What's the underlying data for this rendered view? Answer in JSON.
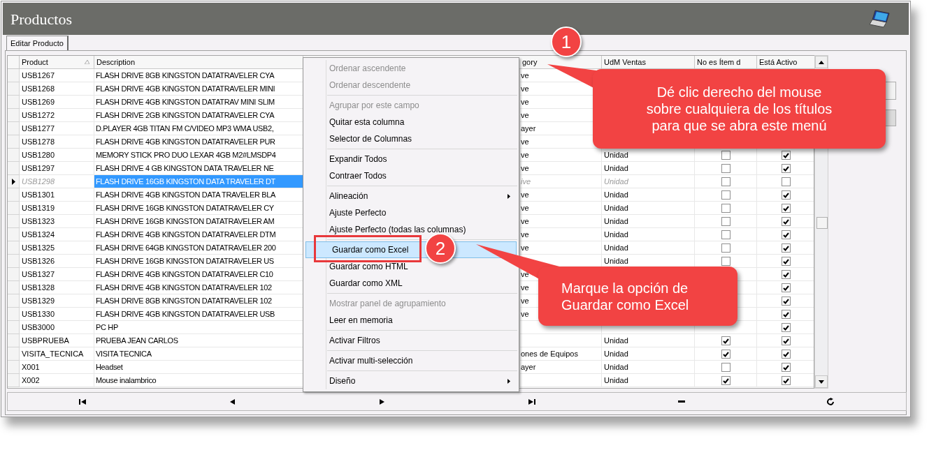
{
  "window": {
    "title": "Productos"
  },
  "tabs": [
    {
      "label": "Editar Producto",
      "selected": true
    }
  ],
  "table": {
    "columns": [
      {
        "label": "Product",
        "sorted": true
      },
      {
        "label": "Description",
        "sorted": false
      },
      {
        "label": "gory",
        "sorted": false
      },
      {
        "label": "UdM Ventas",
        "sorted": false
      },
      {
        "label": "No es Ítem d",
        "sorted": false
      },
      {
        "label": "Está Activo",
        "sorted": false
      }
    ],
    "rows": [
      {
        "current": false,
        "selected": false,
        "product": "USB1267",
        "description": "FLASH DRIVE 8GB KINGSTON DATATRAVELER CYA",
        "category": "ve"
      },
      {
        "current": false,
        "selected": false,
        "product": "USB1268",
        "description": "FLASH DRIVE 4GB KINGSTON DATATRAVELER MINI",
        "category": "ve"
      },
      {
        "current": false,
        "selected": false,
        "product": "USB1269",
        "description": "FLASH DRIVE 4GB KINGSTON DATATRAV MINI SLIM",
        "category": "ve"
      },
      {
        "current": false,
        "selected": false,
        "product": "USB1272",
        "description": "FLASH DRIVE 2GB KINGSTON DATATRAVELER CYA",
        "category": "ve"
      },
      {
        "current": false,
        "selected": false,
        "product": "USB1277",
        "description": "D.PLAYER 4GB TITAN FM C/VIDEO MP3 WMA USB2,",
        "category": "ayer"
      },
      {
        "current": false,
        "selected": false,
        "product": "USB1278",
        "description": "FLASH DRIVE 4GB KINGSTON DATATRAVELER PUR",
        "category": "ve"
      },
      {
        "current": false,
        "selected": false,
        "product": "USB1280",
        "description": "MEMORY STICK PRO DUO LEXAR 4GB M2#LMSDP4",
        "category": "ve",
        "udm": "Unidad",
        "not_item": false,
        "active": true
      },
      {
        "current": false,
        "selected": false,
        "product": "USB1297",
        "description": "FLASH DRIVE 4 GB KINGSTON DATA TRAVELER NE",
        "category": "ve",
        "udm": "Unidad",
        "not_item": false,
        "active": true
      },
      {
        "current": true,
        "selected": true,
        "product": "USB1298",
        "description": "FLASH DRIVE 16GB KINGSTON DATA TRAVELER DT",
        "category": "ive",
        "udm": "Unidad",
        "not_item": false,
        "active": false
      },
      {
        "current": false,
        "selected": false,
        "product": "USB1301",
        "description": "FLASH DRIVE 4GB KINGSTON DATA TRAVELER BLA",
        "category": "ve",
        "udm": "Unidad",
        "not_item": false,
        "active": true
      },
      {
        "current": false,
        "selected": false,
        "product": "USB1319",
        "description": "FLASH DRIVE 16GB KINGSTON DATATRAVELER CY",
        "category": "ve",
        "udm": "Unidad",
        "not_item": false,
        "active": true
      },
      {
        "current": false,
        "selected": false,
        "product": "USB1323",
        "description": "FLASH DRIVE 16GB KINGSTON DATATRAVELER AM",
        "category": "ve",
        "udm": "Unidad",
        "not_item": false,
        "active": true
      },
      {
        "current": false,
        "selected": false,
        "product": "USB1324",
        "description": "FLASH DRIVE 4GB KINGSTON DATATRAVELER DTM",
        "category": "ve",
        "udm": "Unidad",
        "not_item": false,
        "active": true
      },
      {
        "current": false,
        "selected": false,
        "product": "USB1325",
        "description": "FLASH DRIVE 64GB KINGSTON DATATRAVELER 200",
        "category": "ve",
        "udm": "Unidad",
        "not_item": false,
        "active": true
      },
      {
        "current": false,
        "selected": false,
        "product": "USB1326",
        "description": "FLASH DRIVE 16GB KINGSTON DATATRAVELER US",
        "udm": "Unidad",
        "not_item": false,
        "active": true
      },
      {
        "current": false,
        "selected": false,
        "product": "USB1327",
        "description": "FLASH DRIVE 4GB KINGSTON DATATRAVELER C10",
        "category": "ve",
        "active": true
      },
      {
        "current": false,
        "selected": false,
        "product": "USB1328",
        "description": "FLASH DRIVE 4GB KINGSTON DATATRAVELER 102",
        "category": "ve",
        "active": true
      },
      {
        "current": false,
        "selected": false,
        "product": "USB1329",
        "description": "FLASH DRIVE 8GB KINGSTON DATATRAVELER 102",
        "category": "ve",
        "active": true
      },
      {
        "current": false,
        "selected": false,
        "product": "USB1330",
        "description": "FLASH DRIVE 4GB KINGSTON DATATRAVELER USB",
        "category": "ve",
        "active": true
      },
      {
        "current": false,
        "selected": false,
        "product": "USB3000",
        "description": "PC HP",
        "active": true
      },
      {
        "current": false,
        "selected": false,
        "product": "USBPRUEBA",
        "description": "PRUEBA JEAN CARLOS",
        "udm": "Unidad",
        "not_item": true,
        "active": true
      },
      {
        "current": false,
        "selected": false,
        "product": "VISITA_TECNICA",
        "description": "VISITA TECNICA",
        "category": "ones de Equipos",
        "udm": "Unidad",
        "not_item": true,
        "active": true
      },
      {
        "current": false,
        "selected": false,
        "product": "X001",
        "description": "Headset",
        "category": "ayer",
        "udm": "Unidad",
        "not_item": false,
        "active": true
      },
      {
        "current": false,
        "selected": false,
        "product": "X002",
        "description": "Mouse inalambrico",
        "udm": "Unidad",
        "not_item": true,
        "active": true
      }
    ]
  },
  "context_menu": {
    "groups": [
      {
        "items": [
          {
            "label": "Ordenar ascendente",
            "disabled": true,
            "selected": false,
            "submenu": false
          },
          {
            "label": "Ordenar descendente",
            "disabled": true,
            "selected": false,
            "submenu": false
          }
        ]
      },
      {
        "items": [
          {
            "label": "Agrupar por este campo",
            "disabled": true,
            "selected": false,
            "submenu": false
          },
          {
            "label": "Quitar esta columna",
            "disabled": false,
            "selected": false,
            "submenu": false
          },
          {
            "label": "Selector de Columnas",
            "disabled": false,
            "selected": false,
            "submenu": false
          }
        ]
      },
      {
        "items": [
          {
            "label": "Expandir Todos",
            "disabled": false,
            "selected": false,
            "submenu": false
          },
          {
            "label": "Contraer Todos",
            "disabled": false,
            "selected": false,
            "submenu": false
          }
        ]
      },
      {
        "items": [
          {
            "label": "Alineación",
            "disabled": false,
            "selected": false,
            "submenu": true
          },
          {
            "label": "Ajuste Perfecto",
            "disabled": false,
            "selected": false,
            "submenu": false
          },
          {
            "label": "Ajuste Perfecto (todas las columnas)",
            "disabled": false,
            "selected": false,
            "submenu": false
          }
        ]
      },
      {
        "items": [
          {
            "label": "Guardar como Excel",
            "disabled": false,
            "selected": true,
            "submenu": false
          },
          {
            "label": "Guardar como HTML",
            "disabled": false,
            "selected": false,
            "submenu": false
          },
          {
            "label": "Guardar como XML",
            "disabled": false,
            "selected": false,
            "submenu": false
          }
        ]
      },
      {
        "items": [
          {
            "label": "Mostrar panel de agrupamiento",
            "disabled": true,
            "selected": false,
            "submenu": false
          },
          {
            "label": "Leer en memoria",
            "disabled": false,
            "selected": false,
            "submenu": false
          }
        ]
      },
      {
        "items": [
          {
            "label": "Activar Filtros",
            "disabled": false,
            "selected": false,
            "submenu": false
          }
        ]
      },
      {
        "items": [
          {
            "label": "Activar multi-selección",
            "disabled": false,
            "selected": false,
            "submenu": false
          }
        ]
      },
      {
        "items": [
          {
            "label": "Diseño",
            "disabled": false,
            "selected": false,
            "submenu": true
          }
        ]
      }
    ]
  },
  "annotations": [
    {
      "number": "1",
      "text": "Dé clic derecho del mouse\nsobre cualquiera de los títulos\npara que se abra este menú"
    },
    {
      "number": "2",
      "text": "Marque la opción de\nGuardar como Excel"
    }
  ]
}
